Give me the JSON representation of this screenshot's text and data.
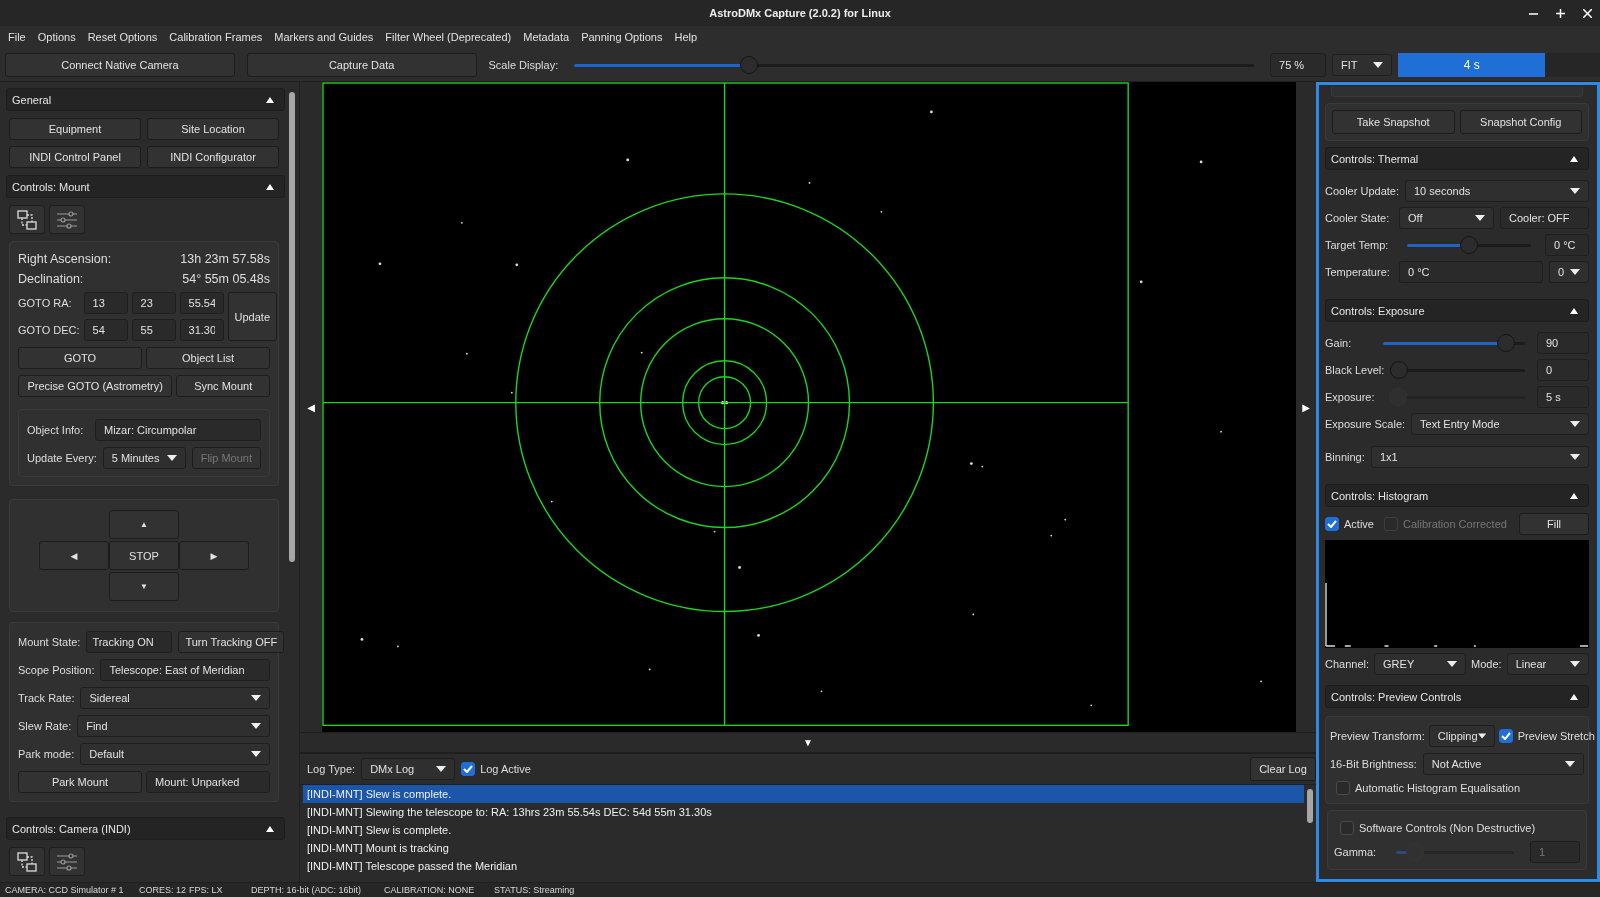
{
  "window": {
    "title": "AstroDMx Capture (2.0.2) for Linux"
  },
  "menu": [
    "File",
    "Options",
    "Reset Options",
    "Calibration Frames",
    "Markers and Guides",
    "Filter Wheel (Deprecated)",
    "Metadata",
    "Panning Options",
    "Help"
  ],
  "toolbar": {
    "buttons": [
      "Connect Native Camera",
      "Capture Data"
    ],
    "scale_label": "Scale Display:",
    "scale_slider": {
      "level": 0.25
    },
    "scale_value": "75 %",
    "fit": "FIT",
    "exposure_progress": {
      "level": 0.73,
      "reading": "4 s"
    }
  },
  "left_panel": {
    "general": {
      "title": "General",
      "expanded": true,
      "buttons": [
        "Equipment",
        "Site Location",
        "INDI Control Panel",
        "INDI Configurator"
      ]
    },
    "mount": {
      "title": "Controls: Mount",
      "expanded": true,
      "ra": {
        "label": "Right Ascension:",
        "value": "13h 23m 57.58s"
      },
      "dec": {
        "label": "Declination:",
        "value": "54° 55m 05.48s"
      },
      "goto_ra": {
        "label": "GOTO RA:",
        "fields": [
          "13",
          "23",
          "55.54"
        ]
      },
      "goto_dec": {
        "label": "GOTO DEC:",
        "fields": [
          "54",
          "55",
          "31.30"
        ]
      },
      "update": "Update",
      "buttons": [
        "GOTO",
        "Object List",
        "Precise GOTO (Astrometry)",
        "Sync Mount"
      ],
      "object_info": {
        "label": "Object Info:",
        "value": "Mizar: Circumpolar"
      },
      "update_every": {
        "label": "Update Every:",
        "value": "5 Minutes"
      },
      "flip_mount": {
        "label": "Flip Mount",
        "disabled": true
      },
      "pad": {
        "up": "▲",
        "left": "◀",
        "stop": "STOP",
        "right": "▶",
        "down": "▼"
      },
      "mount_state": {
        "label": "Mount State:",
        "value": "Tracking ON",
        "button": "Turn Tracking OFF"
      },
      "scope_position": {
        "label": "Scope Position:",
        "value": "Telescope: East of Meridian"
      },
      "selects": [
        {
          "label": "Track Rate:",
          "value": "Sidereal"
        },
        {
          "label": "Slew Rate:",
          "value": "Find"
        },
        {
          "label": "Park mode:",
          "value": "Default"
        }
      ],
      "park_button": "Park Mount",
      "park_state": "Mount: Unparked"
    },
    "camera": {
      "title": "Controls: Camera (INDI)",
      "expanded": true
    }
  },
  "viewer": {
    "nav_left": "◀",
    "nav_right": "▶",
    "nav_down": "▼"
  },
  "log": {
    "type_label": "Log Type:",
    "type": "DMx Log",
    "active": {
      "label": "Log Active",
      "checked": true
    },
    "clear": "Clear Log",
    "entries": [
      {
        "text": "[INDI-MNT] Slew is complete.",
        "selected": true
      },
      {
        "text": "[INDI-MNT] Slewing the telescope to: RA: 13hrs 23m 55.54s DEC: 54d 55m 31.30s",
        "selected": false
      },
      {
        "text": "[INDI-MNT] Slew is complete.",
        "selected": false
      },
      {
        "text": "[INDI-MNT] Mount is tracking",
        "selected": false
      },
      {
        "text": "[INDI-MNT] Telescope passed the Meridian",
        "selected": false
      }
    ]
  },
  "right_panel": {
    "snapshot": [
      "Take Snapshot",
      "Snapshot Config"
    ],
    "thermal": {
      "title": "Controls: Thermal",
      "expanded": true,
      "cooler_update": {
        "label": "Cooler Update:",
        "value": "10 seconds"
      },
      "cooler_state": {
        "label": "Cooler State:",
        "value": "Off",
        "status": "Cooler: OFF"
      },
      "target_temp": {
        "label": "Target Temp:",
        "level": 0.5,
        "value": "0 °C"
      },
      "temperature": {
        "label": "Temperature:",
        "value": "0 °C",
        "unit": "0"
      }
    },
    "exposure": {
      "title": "Controls: Exposure",
      "expanded": true,
      "sliders": [
        {
          "label": "Gain:",
          "level": 0.92,
          "value": "90",
          "disabled": false
        },
        {
          "label": "Black Level:",
          "level": 0,
          "value": "0",
          "disabled": false
        },
        {
          "label": "Exposure:",
          "level": 0,
          "value": "5 s",
          "disabled": true
        }
      ],
      "scale": {
        "label": "Exposure Scale:",
        "value": "Text Entry Mode"
      },
      "binning": {
        "label": "Binning:",
        "value": "1x1"
      }
    },
    "histogram": {
      "title": "Controls: Histogram",
      "expanded": true,
      "checks": [
        {
          "label": "Active",
          "checked": true,
          "disabled": false
        },
        {
          "label": "Calibration Corrected",
          "checked": false,
          "disabled": true
        }
      ],
      "fill": "Fill",
      "channel": {
        "label": "Channel:",
        "value": "GREY"
      },
      "mode": {
        "label": "Mode:",
        "value": "Linear"
      }
    },
    "preview": {
      "title": "Controls: Preview Controls",
      "expanded": true,
      "transform": {
        "label": "Preview Transform:",
        "value": "Clipping"
      },
      "stretch": {
        "label": "Preview Stretch",
        "checked": true
      },
      "brightness": {
        "label": "16-Bit Brightness:",
        "value": "Not Active"
      },
      "equalisation": {
        "label": "Automatic Histogram Equalisation",
        "checked": false
      },
      "software": {
        "label": "Software Controls (Non Destructive)",
        "checked": false
      },
      "gamma": {
        "label": "Gamma:",
        "level": 0.1,
        "value": "1",
        "disabled": true
      }
    }
  },
  "status_bar": [
    "CAMERA: CCD Simulator # 1",
    "CORES: 12",
    "FPS: LX",
    "DEPTH: 16-bit (ADC: 16bit)",
    "CALIBRATION: NONE",
    "STATUS: Streaming"
  ]
}
